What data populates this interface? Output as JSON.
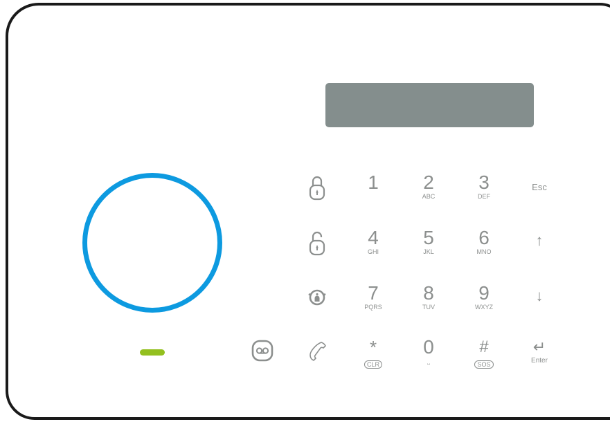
{
  "device": {
    "display_text": "",
    "icons": {
      "lock": "lock-icon",
      "unlock": "unlock-icon",
      "home": "home-arm-icon",
      "voicemail": "voicemail-icon",
      "call": "phone-icon"
    },
    "colors": {
      "ring": "#0d9ae0",
      "led": "#93c01f",
      "screen": "#848e8d"
    }
  },
  "keypad": {
    "k1": {
      "digit": "1",
      "letters": ""
    },
    "k2": {
      "digit": "2",
      "letters": "ABC"
    },
    "k3": {
      "digit": "3",
      "letters": "DEF"
    },
    "k4": {
      "digit": "4",
      "letters": "GHI"
    },
    "k5": {
      "digit": "5",
      "letters": "JKL"
    },
    "k6": {
      "digit": "6",
      "letters": "MNO"
    },
    "k7": {
      "digit": "7",
      "letters": "PQRS"
    },
    "k8": {
      "digit": "8",
      "letters": "TUV"
    },
    "k9": {
      "digit": "9",
      "letters": "WXYZ"
    },
    "k0": {
      "digit": "0",
      "letters": ""
    },
    "star": {
      "symbol": "*",
      "label": "CLR"
    },
    "hash": {
      "symbol": "#",
      "label": "SOS"
    },
    "esc": "Esc",
    "up": "↑",
    "down": "↓",
    "enter": {
      "symbol": "↵",
      "label": "Enter"
    }
  }
}
